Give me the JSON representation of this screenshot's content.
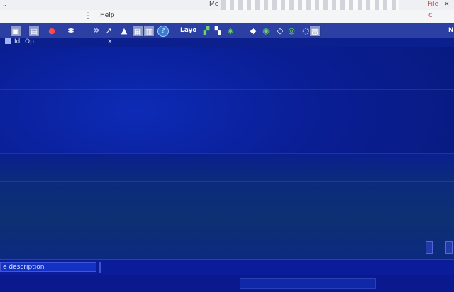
{
  "titlebar": {
    "title": "Mc",
    "file_label": "File",
    "close_glyph": "×"
  },
  "menubar": {
    "help_label": "Help",
    "right_label": "c"
  },
  "toolbar": {
    "layout_label": "Layo",
    "right_label": "N"
  },
  "subtoolbar": {
    "options_label": "Op",
    "icon_label": "Id",
    "close_glyph": "×"
  },
  "status": {
    "description_placeholder": "e description"
  },
  "icons": {
    "save": "save-icon",
    "open": "open-icon",
    "record": "record-icon",
    "star": "star-icon",
    "expand": "expand-icon",
    "help": "help-icon"
  }
}
